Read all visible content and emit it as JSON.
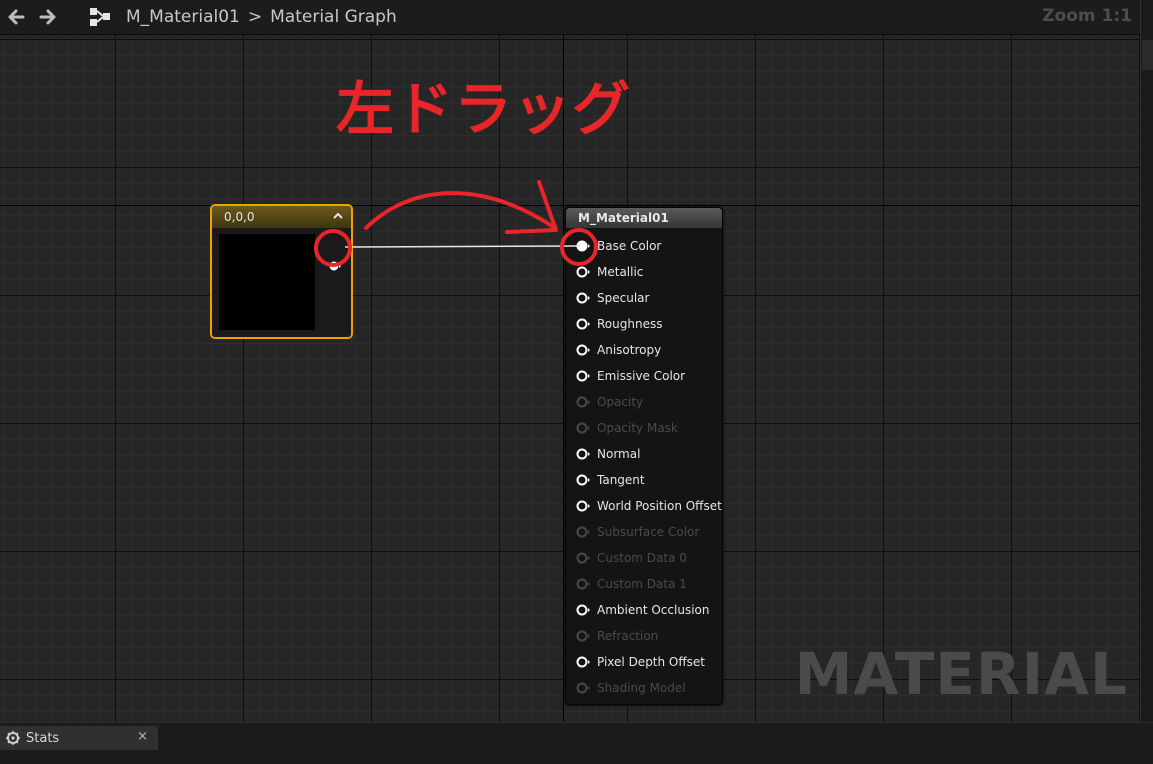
{
  "toolbar": {
    "breadcrumb_asset": "M_Material01",
    "breadcrumb_separator": ">",
    "breadcrumb_graph": "Material Graph",
    "zoom_label": "Zoom 1:1"
  },
  "graph": {
    "watermark": "MATERIAL",
    "constant_node": {
      "title": "0,0,0"
    },
    "material_node": {
      "title": "M_Material01",
      "inputs": [
        {
          "label": "Base Color",
          "enabled": true,
          "connected": true
        },
        {
          "label": "Metallic",
          "enabled": true
        },
        {
          "label": "Specular",
          "enabled": true
        },
        {
          "label": "Roughness",
          "enabled": true
        },
        {
          "label": "Anisotropy",
          "enabled": true
        },
        {
          "label": "Emissive Color",
          "enabled": true
        },
        {
          "label": "Opacity",
          "enabled": false
        },
        {
          "label": "Opacity Mask",
          "enabled": false
        },
        {
          "label": "Normal",
          "enabled": true
        },
        {
          "label": "Tangent",
          "enabled": true
        },
        {
          "label": "World Position Offset",
          "enabled": true
        },
        {
          "label": "Subsurface Color",
          "enabled": false
        },
        {
          "label": "Custom Data 0",
          "enabled": false
        },
        {
          "label": "Custom Data 1",
          "enabled": false
        },
        {
          "label": "Ambient Occlusion",
          "enabled": true
        },
        {
          "label": "Refraction",
          "enabled": false
        },
        {
          "label": "Pixel Depth Offset",
          "enabled": true
        },
        {
          "label": "Shading Model",
          "enabled": false
        }
      ]
    }
  },
  "annotation": {
    "text": "左ドラッグ",
    "color": "#e8262a"
  },
  "bottom_tabs": [
    {
      "label": "Stats",
      "close": "×"
    }
  ],
  "colors": {
    "accent_selected": "#f0a000",
    "canvas_bg": "#262626"
  }
}
